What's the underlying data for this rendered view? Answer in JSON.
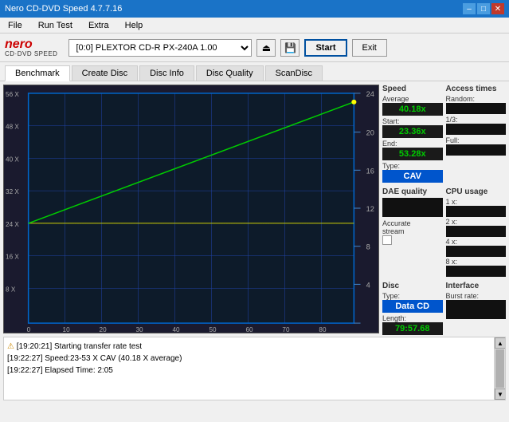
{
  "titleBar": {
    "title": "Nero CD-DVD Speed 4.7.7.16",
    "minimizeBtn": "–",
    "maximizeBtn": "□",
    "closeBtn": "✕"
  },
  "menuBar": {
    "items": [
      "File",
      "Run Test",
      "Extra",
      "Help"
    ]
  },
  "toolbar": {
    "logoNero": "nero",
    "logoCdDvd": "CD·DVD SPEED",
    "driveValue": "[0:0]  PLEXTOR CD-R  PX-240A 1.00",
    "startLabel": "Start",
    "exitLabel": "Exit"
  },
  "tabs": {
    "items": [
      "Benchmark",
      "Create Disc",
      "Disc Info",
      "Disc Quality",
      "ScanDisc"
    ],
    "active": 0
  },
  "rightPanel": {
    "speedSection": {
      "label": "Speed",
      "average": {
        "label": "Average",
        "value": "40.18x"
      },
      "start": {
        "label": "Start:",
        "value": "23.36x"
      },
      "end": {
        "label": "End:",
        "value": "53.28x"
      },
      "type": {
        "label": "Type:",
        "value": "CAV"
      }
    },
    "accessTimes": {
      "label": "Access times",
      "random": {
        "label": "Random:",
        "value": ""
      },
      "oneThird": {
        "label": "1/3:",
        "value": ""
      },
      "full": {
        "label": "Full:",
        "value": ""
      }
    },
    "daeQuality": {
      "label": "DAE quality",
      "value": ""
    },
    "cpuUsage": {
      "label": "CPU usage",
      "oneX": {
        "label": "1 x:",
        "value": ""
      },
      "twoX": {
        "label": "2 x:",
        "value": ""
      },
      "fourX": {
        "label": "4 x:",
        "value": ""
      },
      "eightX": {
        "label": "8 x:",
        "value": ""
      }
    },
    "accurateStream": {
      "label": "Accurate stream"
    },
    "discType": {
      "label": "Disc",
      "typeLabel": "Type:",
      "typeValue": "Data CD",
      "lengthLabel": "Length:",
      "lengthValue": "79:57.68"
    },
    "interface": {
      "label": "Interface",
      "burstRate": {
        "label": "Burst rate:",
        "value": ""
      }
    }
  },
  "chart": {
    "xAxisLabel": "80",
    "yAxisLeftMax": "56 X",
    "yAxisRightMax": "24",
    "gridLines": {
      "xLabels": [
        "0",
        "10",
        "20",
        "30",
        "40",
        "50",
        "60",
        "70",
        "80"
      ],
      "yLabelsLeft": [
        "56 X",
        "48 X",
        "40 X",
        "32 X",
        "24 X",
        "16 X",
        "8 X"
      ],
      "yLabelsRight": [
        "24",
        "20",
        "16",
        "12",
        "8",
        "4"
      ]
    }
  },
  "log": {
    "lines": [
      "[19:20:21]  Starting transfer rate test",
      "[19:22:27]  Speed:23-53 X CAV (40.18 X average)",
      "[19:22:27]  Elapsed Time: 2:05"
    ]
  },
  "statusIcon": "⚠",
  "icons": {
    "eject": "⏏",
    "save": "💾",
    "upArrow": "▲",
    "downArrow": "▼"
  }
}
